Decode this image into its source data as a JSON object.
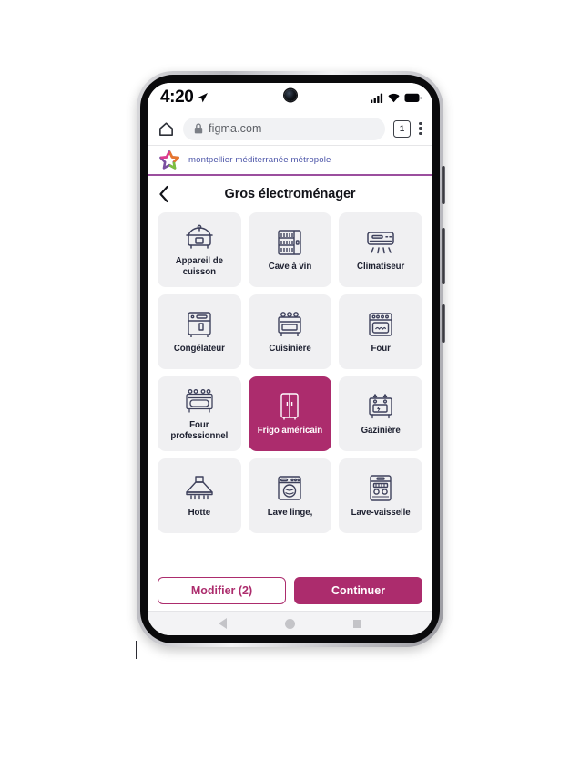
{
  "status_bar": {
    "time": "4:20",
    "location_icon": "location-arrow-icon",
    "signal_icon": "cellular-signal-icon",
    "wifi_icon": "wifi-icon",
    "battery_icon": "battery-icon"
  },
  "browser": {
    "home_icon": "home-icon",
    "lock_icon": "lock-icon",
    "url": "figma.com",
    "tab_count": "1",
    "menu_icon": "kebab-menu-icon"
  },
  "brand": {
    "logo_icon": "montpellier-star-logo-icon",
    "name": "montpellier méditerranée métropole",
    "logo_colors": [
      "#e8762c",
      "#7bbf3f",
      "#7b4fa0",
      "#e03a8e"
    ],
    "underline_color": "#9b4f9e"
  },
  "header": {
    "back_icon": "back-chevron-icon",
    "title": "Gros électroménager"
  },
  "theme": {
    "accent": "#ac2c6d",
    "tile_bg": "#f0f0f2",
    "tile_text": "#1d2030",
    "selected_text": "#ffffff"
  },
  "grid": {
    "tiles": [
      {
        "label": "Appareil de cuisson",
        "icon": "rice-cooker-icon",
        "selected": false
      },
      {
        "label": "Cave à vin",
        "icon": "wine-cellar-icon",
        "selected": false
      },
      {
        "label": "Climatiseur",
        "icon": "air-conditioner-icon",
        "selected": false
      },
      {
        "label": "Congélateur",
        "icon": "freezer-icon",
        "selected": false
      },
      {
        "label": "Cuisinière",
        "icon": "cooker-icon",
        "selected": false
      },
      {
        "label": "Four",
        "icon": "oven-icon",
        "selected": false
      },
      {
        "label": "Four professionnel",
        "icon": "professional-oven-icon",
        "selected": false
      },
      {
        "label": "Frigo américain",
        "icon": "american-fridge-icon",
        "selected": true
      },
      {
        "label": "Gazinière",
        "icon": "gas-stove-icon",
        "selected": false
      },
      {
        "label": "Hotte",
        "icon": "range-hood-icon",
        "selected": false
      },
      {
        "label": "Lave linge,",
        "icon": "washing-machine-icon",
        "selected": false
      },
      {
        "label": "Lave-vaisselle",
        "icon": "dishwasher-icon",
        "selected": false
      }
    ]
  },
  "actions": {
    "modify_label": "Modifier (2)",
    "continue_label": "Continuer"
  },
  "android_nav": {
    "back_icon": "nav-back-icon",
    "home_icon": "nav-home-icon",
    "recents_icon": "nav-recents-icon"
  }
}
